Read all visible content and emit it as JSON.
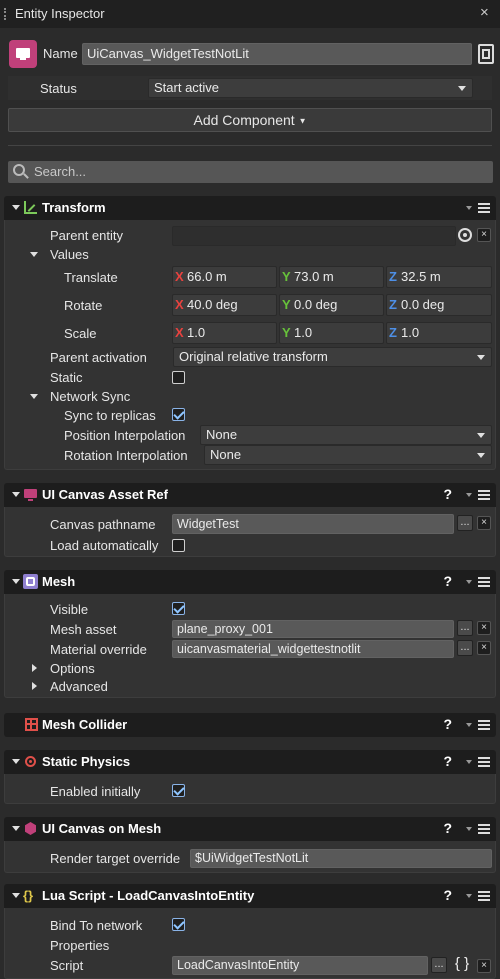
{
  "window": {
    "title": "Entity Inspector"
  },
  "entity": {
    "name_label": "Name",
    "name_value": "UiCanvas_WidgetTestNotLit",
    "status_label": "Status",
    "status_value": "Start active",
    "add_component": "Add Component",
    "search_placeholder": "Search..."
  },
  "transform": {
    "title": "Transform",
    "parent_entity_label": "Parent entity",
    "values_label": "Values",
    "translate_label": "Translate",
    "translate": {
      "x": "66.0 m",
      "y": "73.0 m",
      "z": "32.5 m"
    },
    "rotate_label": "Rotate",
    "rotate": {
      "x": "40.0 deg",
      "y": "0.0 deg",
      "z": "0.0 deg"
    },
    "scale_label": "Scale",
    "scale": {
      "x": "1.0",
      "y": "1.0",
      "z": "1.0"
    },
    "axis": {
      "x": "X",
      "y": "Y",
      "z": "Z"
    },
    "parent_activation_label": "Parent activation",
    "parent_activation_value": "Original relative transform",
    "static_label": "Static",
    "network_sync_label": "Network Sync",
    "sync_label": "Sync to replicas",
    "pos_interp_label": "Position Interpolation",
    "pos_interp_value": "None",
    "rot_interp_label": "Rotation Interpolation",
    "rot_interp_value": "None"
  },
  "ui_canvas_asset": {
    "title": "UI Canvas Asset Ref",
    "help": "?",
    "pathname_label": "Canvas pathname",
    "pathname_value": "WidgetTest",
    "load_auto_label": "Load automatically"
  },
  "mesh": {
    "title": "Mesh",
    "help": "?",
    "visible_label": "Visible",
    "asset_label": "Mesh asset",
    "asset_value": "plane_proxy_001",
    "material_label": "Material override",
    "material_value": "uicanvasmaterial_widgettestnotlit",
    "options_label": "Options",
    "advanced_label": "Advanced"
  },
  "mesh_collider": {
    "title": "Mesh Collider",
    "help": "?"
  },
  "static_physics": {
    "title": "Static Physics",
    "help": "?",
    "enabled_label": "Enabled initially"
  },
  "ui_canvas_mesh": {
    "title": "UI Canvas on Mesh",
    "help": "?",
    "render_label": "Render target override",
    "render_value": "$UiWidgetTestNotLit"
  },
  "lua": {
    "title": "Lua Script - LoadCanvasIntoEntity",
    "help": "?",
    "bind_label": "Bind To network",
    "properties_label": "Properties",
    "script_label": "Script",
    "script_value": "LoadCanvasIntoEntity",
    "browse": "...",
    "braces": "{ }"
  },
  "common": {
    "browse": "...",
    "clear": "×"
  },
  "colors": {
    "axis_x": "#e8423f",
    "axis_y": "#67c23a",
    "axis_z": "#4e8fe6",
    "accent_entity_icon": "#c0407a"
  }
}
